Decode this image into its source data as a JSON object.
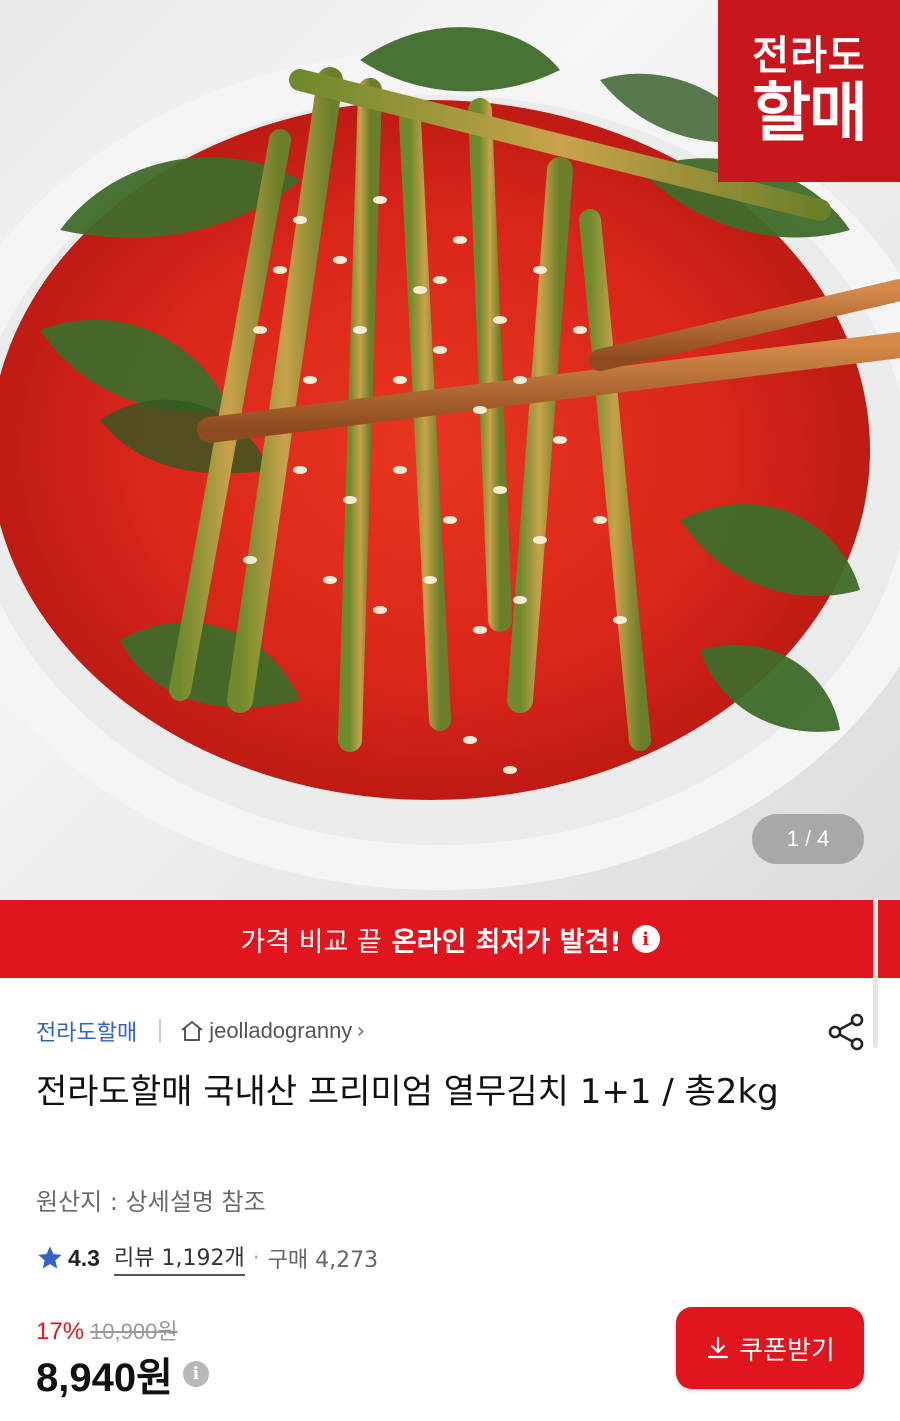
{
  "hero": {
    "brand_stamp_line1": "전라도",
    "brand_stamp_line2": "할매",
    "pager_current": "1",
    "pager_separator": "/",
    "pager_total": "4"
  },
  "banner": {
    "prefix": "가격 비교 끝",
    "highlight": "온라인 최저가 발견!",
    "info_glyph": "i"
  },
  "store": {
    "name": "전라도할매",
    "id": "jeolladogranny",
    "chevron": "›"
  },
  "product": {
    "title": "전라도할매 국내산 프리미엄 열무김치 1+1 / 총2kg",
    "origin": "원산지 : 상세설명 참조"
  },
  "rating": {
    "value": "4.3",
    "review_label": "리뷰 1,192개",
    "separator": "·",
    "purchase_label": "구매 4,273"
  },
  "price": {
    "discount": "17%",
    "original": "10,900원",
    "final": "8,940원",
    "info_glyph": "i"
  },
  "coupon": {
    "label": "쿠폰받기"
  },
  "colors": {
    "accent_red": "#e0151d",
    "store_blue": "#2f63c8",
    "star_blue": "#2f63c8"
  }
}
